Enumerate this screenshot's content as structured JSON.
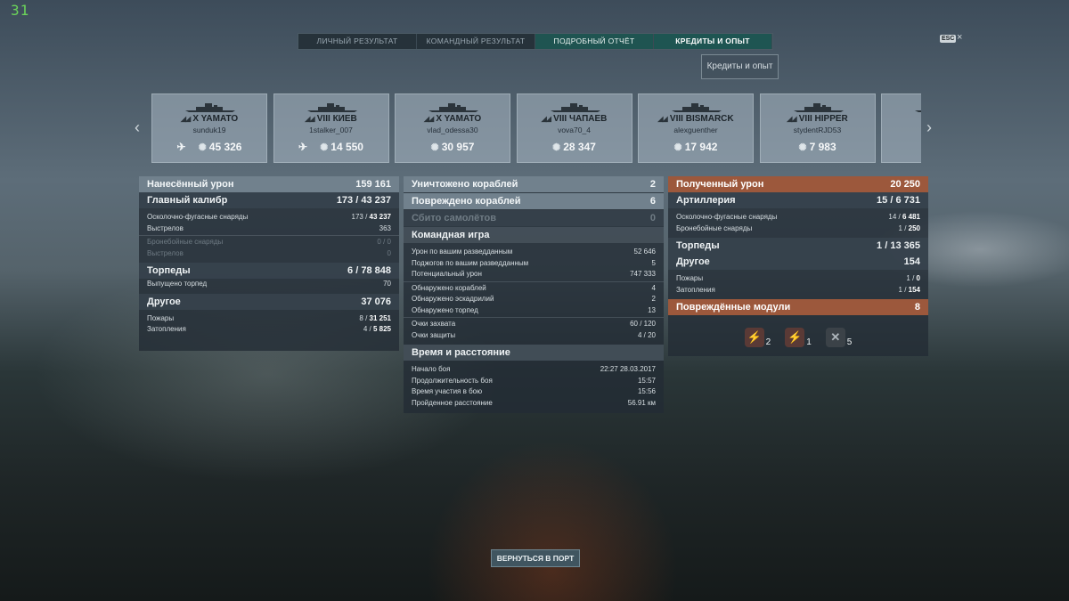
{
  "fps": "31",
  "tabs": [
    "ЛИЧНЫЙ РЕЗУЛЬТАТ",
    "КОМАНДНЫЙ РЕЗУЛЬТАТ",
    "ПОДРОБНЫЙ ОТЧЁТ",
    "КРЕДИТЫ И ОПЫТ"
  ],
  "esc_label": "ESC",
  "close_glyph": "×",
  "credits_button": "Кредиты и опыт",
  "ships": [
    {
      "tier": "X",
      "name": "YAMATO",
      "player": "sunduk19",
      "damage": "45 326",
      "plane": true
    },
    {
      "tier": "VIII",
      "name": "КИЕВ",
      "player": "1stalker_007",
      "damage": "14 550",
      "plane": true
    },
    {
      "tier": "X",
      "name": "YAMATO",
      "player": "vlad_odessa30",
      "damage": "30 957",
      "plane": false
    },
    {
      "tier": "VIII",
      "name": "ЧАПАЕВ",
      "player": "vova70_4",
      "damage": "28 347",
      "plane": false
    },
    {
      "tier": "VIII",
      "name": "BISMARCK",
      "player": "alexguenther",
      "damage": "17 942",
      "plane": false
    },
    {
      "tier": "VIII",
      "name": "HIPPER",
      "player": "stydentRJD53",
      "damage": "7 983",
      "plane": false
    },
    {
      "tier": "",
      "name": "",
      "player": "",
      "damage": "",
      "plane": false
    }
  ],
  "left": {
    "dealt": {
      "label": "Нанесённый урон",
      "value": "159 161"
    },
    "main": {
      "label": "Главный калибр",
      "a": "173",
      "b": "43 237"
    },
    "he": {
      "label": "Осколочно-фугасные снаряды",
      "a": "173",
      "b": "43 237"
    },
    "he_shots": {
      "label": "Выстрелов",
      "value": "363"
    },
    "ap": {
      "label": "Бронебойные снаряды",
      "a": "0",
      "b": "0"
    },
    "ap_shots": {
      "label": "Выстрелов",
      "value": "0"
    },
    "torp": {
      "label": "Торпеды",
      "a": "6",
      "b": "78 848"
    },
    "torp_fired": {
      "label": "Выпущено торпед",
      "value": "70"
    },
    "other": {
      "label": "Другое",
      "value": "37 076"
    },
    "fires": {
      "label": "Пожары",
      "a": "8",
      "b": "31 251"
    },
    "floods": {
      "label": "Затопления",
      "a": "4",
      "b": "5 825"
    }
  },
  "mid": {
    "destroyed": {
      "label": "Уничтожено кораблей",
      "value": "2"
    },
    "damaged": {
      "label": "Повреждено кораблей",
      "value": "6"
    },
    "planes": {
      "label": "Сбито самолётов",
      "value": "0"
    },
    "team_title": "Командная игра",
    "team_rows": [
      {
        "label": "Урон по вашим разведданным",
        "value": "52 646"
      },
      {
        "label": "Поджогов по вашим разведданным",
        "value": "5"
      },
      {
        "label": "Потенциальный урон",
        "value": "747 333"
      },
      {
        "label": "Обнаружено кораблей",
        "value": "4"
      },
      {
        "label": "Обнаружено эскадрилий",
        "value": "2"
      },
      {
        "label": "Обнаружено торпед",
        "value": "13"
      },
      {
        "label": "Очки захвата",
        "value": "60 / 120"
      },
      {
        "label": "Очки защиты",
        "value": "4 / 20"
      }
    ],
    "time_title": "Время и расстояние",
    "time_rows": [
      {
        "label": "Начало боя",
        "value": "22:27  28.03.2017"
      },
      {
        "label": "Продолжительность боя",
        "value": "15:57"
      },
      {
        "label": "Время участия в бою",
        "value": "15:56"
      },
      {
        "label": "Пройденное расстояние",
        "value": "56.91 км"
      }
    ]
  },
  "right": {
    "received": {
      "label": "Полученный урон",
      "value": "20 250"
    },
    "art": {
      "label": "Артиллерия",
      "a": "15",
      "b": "6 731"
    },
    "he": {
      "label": "Осколочно-фугасные снаряды",
      "a": "14",
      "b": "6 481"
    },
    "ap": {
      "label": "Бронебойные снаряды",
      "a": "1",
      "b": "250"
    },
    "torp": {
      "label": "Торпеды",
      "a": "1",
      "b": "13 365"
    },
    "other": {
      "label": "Другое",
      "value": "154"
    },
    "fires": {
      "label": "Пожары",
      "a": "1",
      "b": "0"
    },
    "floods": {
      "label": "Затопления",
      "a": "1",
      "b": "154"
    },
    "modules": {
      "label": "Повреждённые модули",
      "value": "8"
    },
    "module_counts": [
      "2",
      "1",
      "5"
    ]
  },
  "back_button": "ВЕРНУТЬСЯ В ПОРТ"
}
